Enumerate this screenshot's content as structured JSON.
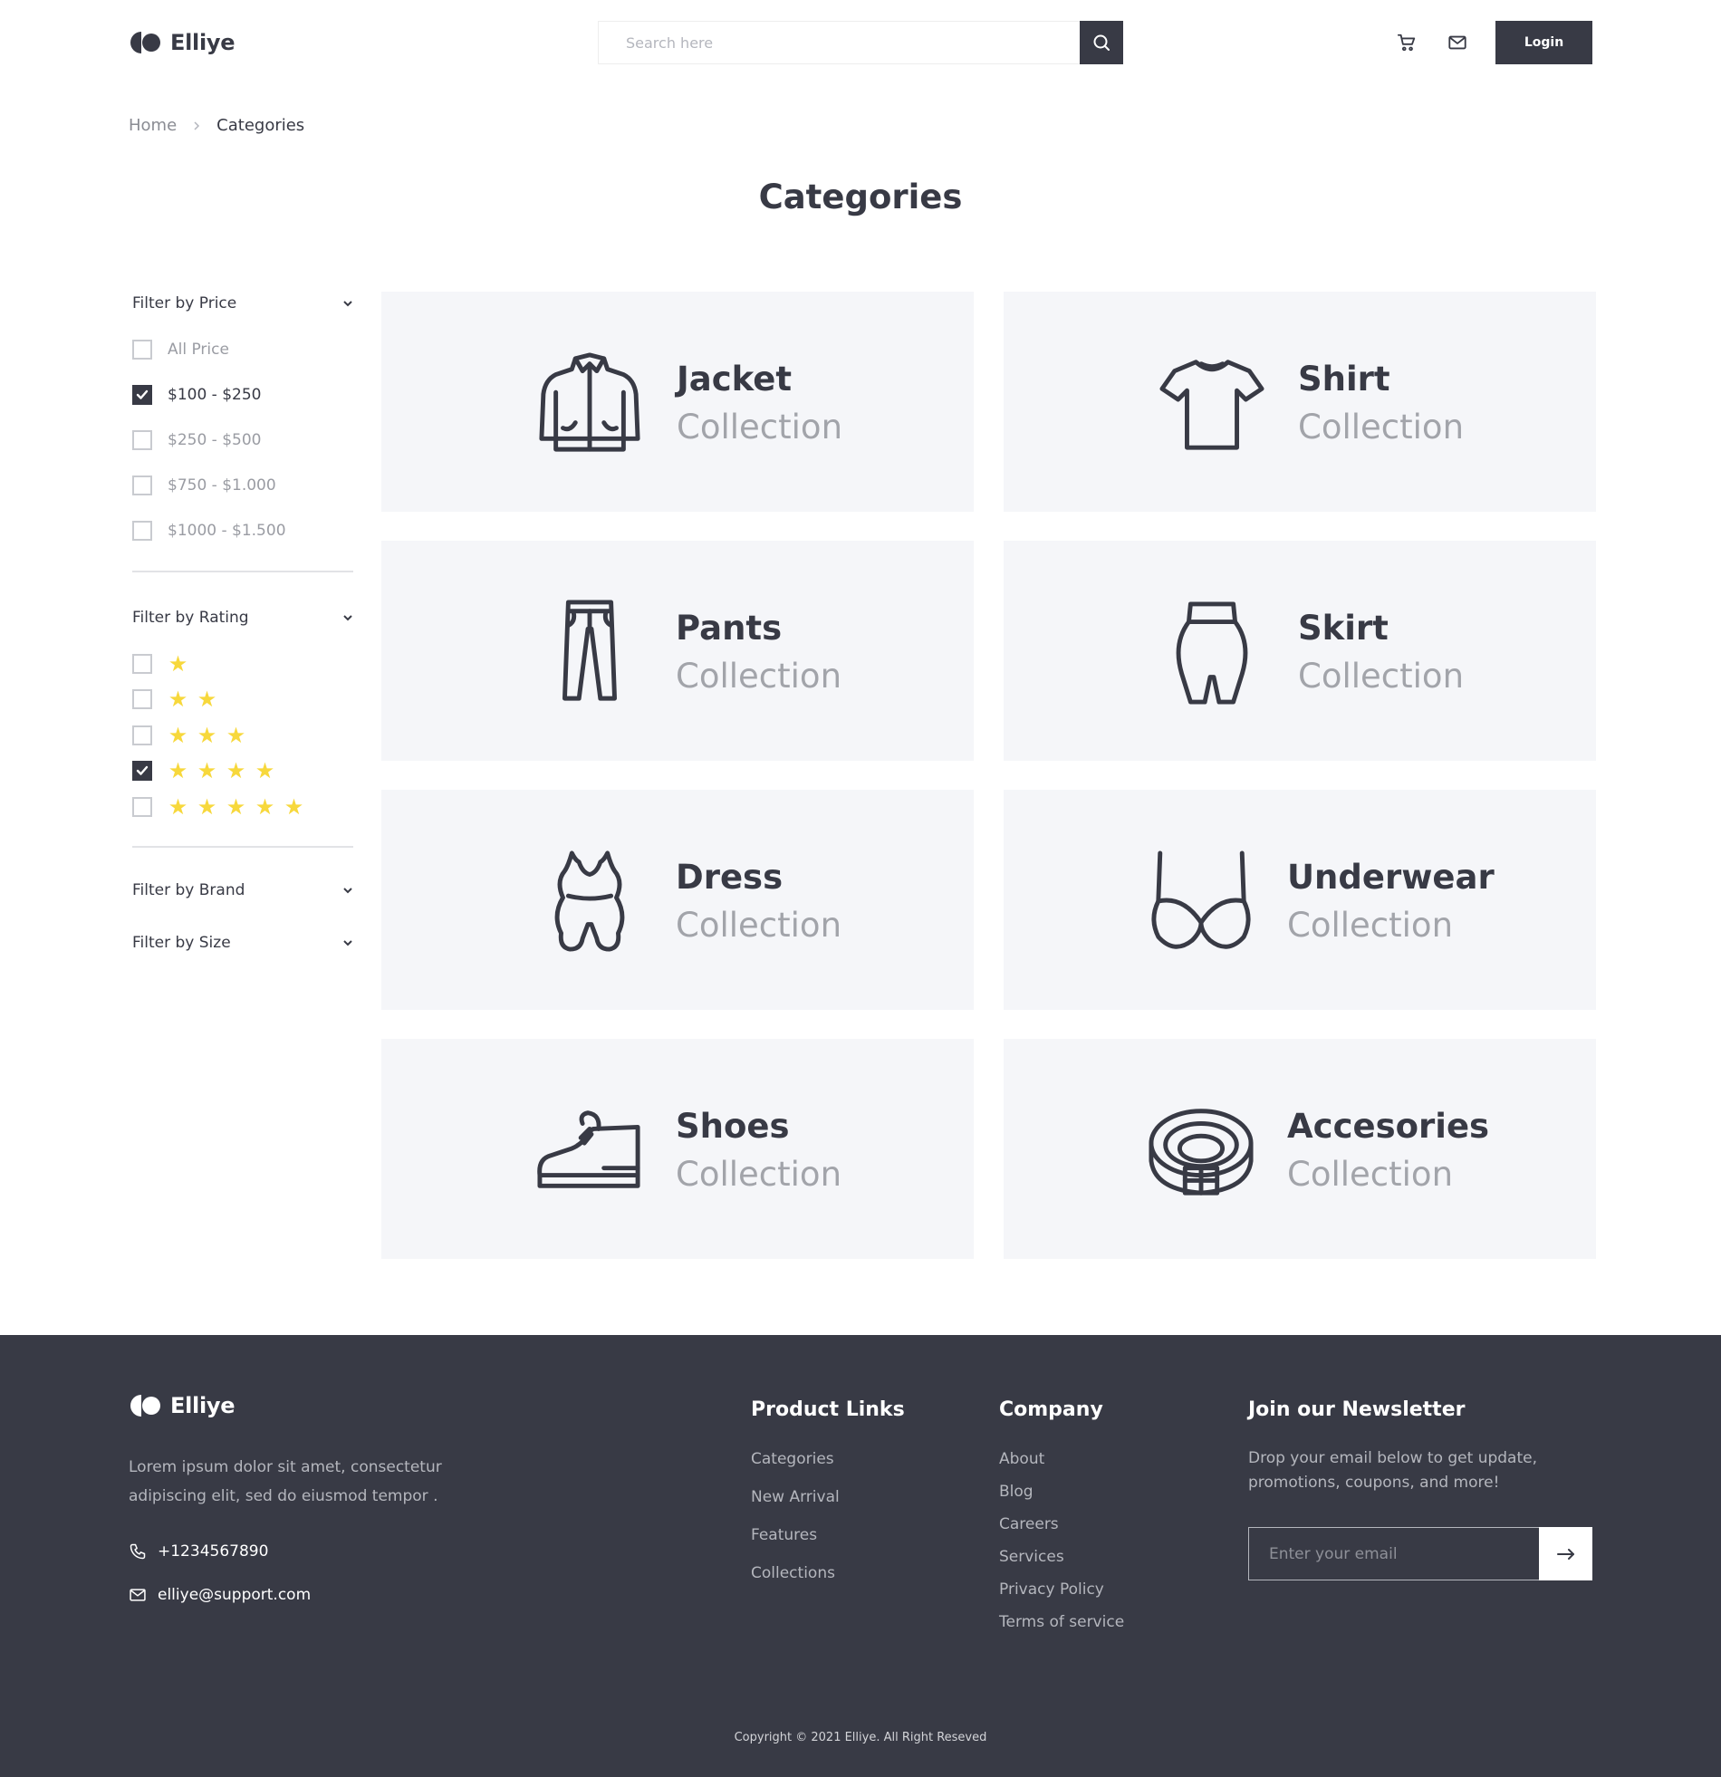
{
  "brand": {
    "name": "Elliye"
  },
  "header": {
    "search_placeholder": "Search here",
    "login_label": "Login"
  },
  "breadcrumb": {
    "home": "Home",
    "current": "Categories"
  },
  "page_title": "Categories",
  "filters": {
    "price": {
      "title": "Filter by Price",
      "options": [
        {
          "label": "All Price",
          "checked": false
        },
        {
          "label": "$100 - $250",
          "checked": true
        },
        {
          "label": "$250 - $500",
          "checked": false
        },
        {
          "label": "$750 - $1.000",
          "checked": false
        },
        {
          "label": "$1000 - $1.500",
          "checked": false
        }
      ]
    },
    "rating": {
      "title": "Filter by Rating",
      "options": [
        {
          "stars": 1,
          "checked": false
        },
        {
          "stars": 2,
          "checked": false
        },
        {
          "stars": 3,
          "checked": false
        },
        {
          "stars": 4,
          "checked": true
        },
        {
          "stars": 5,
          "checked": false
        }
      ]
    },
    "brand": {
      "title": "Filter by Brand"
    },
    "size": {
      "title": "Filter by Size"
    }
  },
  "categories": [
    {
      "name": "Jacket",
      "sub": "Collection",
      "icon": "jacket-icon"
    },
    {
      "name": "Shirt",
      "sub": "Collection",
      "icon": "shirt-icon"
    },
    {
      "name": "Pants",
      "sub": "Collection",
      "icon": "pants-icon"
    },
    {
      "name": "Skirt",
      "sub": "Collection",
      "icon": "skirt-icon"
    },
    {
      "name": "Dress",
      "sub": "Collection",
      "icon": "dress-icon"
    },
    {
      "name": "Underwear",
      "sub": "Collection",
      "icon": "underwear-icon"
    },
    {
      "name": "Shoes",
      "sub": "Collection",
      "icon": "shoe-icon"
    },
    {
      "name": "Accesories",
      "sub": "Collection",
      "icon": "belt-icon"
    }
  ],
  "footer": {
    "description": "Lorem ipsum dolor sit amet, consectetur adipiscing elit, sed do eiusmod tempor .",
    "phone": "+1234567890",
    "email": "elliye@support.com",
    "product_links": {
      "title": "Product Links",
      "links": [
        "Categories",
        "New Arrival",
        "Features",
        "Collections"
      ]
    },
    "company": {
      "title": "Company",
      "links": [
        "About",
        "Blog",
        "Careers",
        "Services",
        "Privacy Policy",
        "Terms of service"
      ]
    },
    "newsletter": {
      "title": "Join our Newsletter",
      "text": "Drop your email below to get update, promotions, coupons, and more!",
      "placeholder": "Enter your email"
    },
    "copyright": "Copyright © 2021 Elliye. All Right Reseved"
  },
  "colors": {
    "primary": "#383a45",
    "card_bg": "#f5f6f9",
    "star": "#f7d83c",
    "muted_text": "#a2a4aa"
  }
}
